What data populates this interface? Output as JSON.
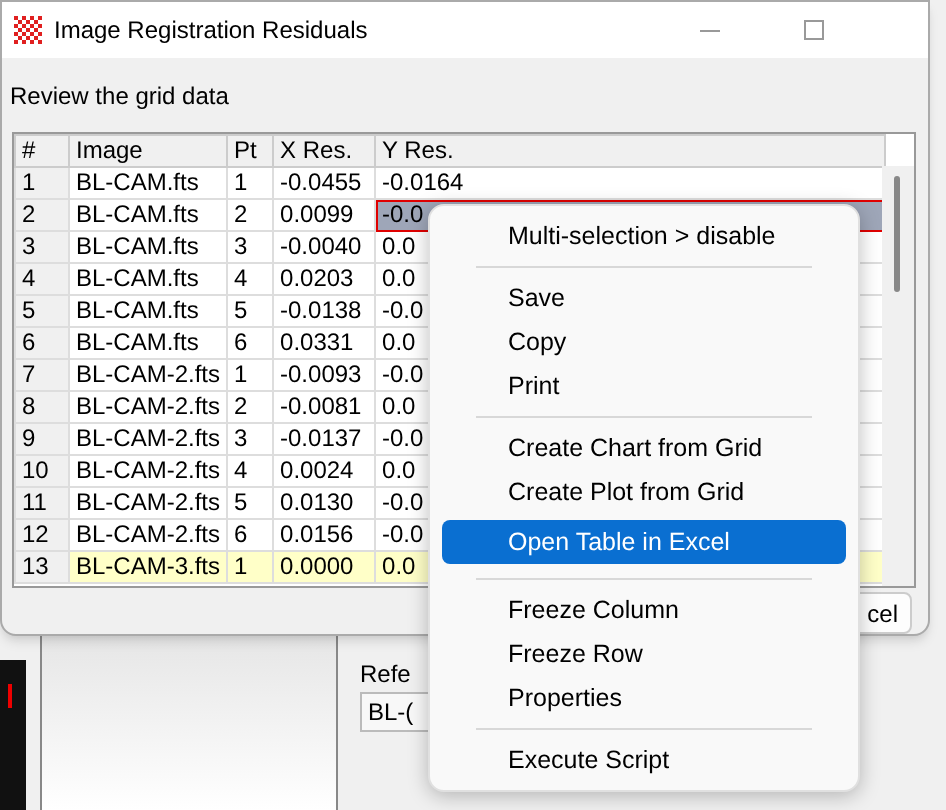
{
  "window": {
    "title": "Image Registration Residuals"
  },
  "prompt": "Review the grid data",
  "table": {
    "columns": [
      "#",
      "Image",
      "Pt",
      "X Res.",
      "Y Res."
    ],
    "rows": [
      {
        "cells": [
          "1",
          "BL-CAM.fts",
          "1",
          "-0.0455",
          "-0.0164"
        ],
        "selected": false,
        "cell_selected": false
      },
      {
        "cells": [
          "2",
          "BL-CAM.fts",
          "2",
          "0.0099",
          "-0.0"
        ],
        "selected": false,
        "cell_selected": true
      },
      {
        "cells": [
          "3",
          "BL-CAM.fts",
          "3",
          "-0.0040",
          "0.0"
        ],
        "selected": false,
        "cell_selected": false
      },
      {
        "cells": [
          "4",
          "BL-CAM.fts",
          "4",
          "0.0203",
          "0.0"
        ],
        "selected": false,
        "cell_selected": false
      },
      {
        "cells": [
          "5",
          "BL-CAM.fts",
          "5",
          "-0.0138",
          "-0.0"
        ],
        "selected": false,
        "cell_selected": false
      },
      {
        "cells": [
          "6",
          "BL-CAM.fts",
          "6",
          "0.0331",
          "0.0"
        ],
        "selected": false,
        "cell_selected": false
      },
      {
        "cells": [
          "7",
          "BL-CAM-2.fts",
          "1",
          "-0.0093",
          "-0.0"
        ],
        "selected": false,
        "cell_selected": false
      },
      {
        "cells": [
          "8",
          "BL-CAM-2.fts",
          "2",
          "-0.0081",
          "0.0"
        ],
        "selected": false,
        "cell_selected": false
      },
      {
        "cells": [
          "9",
          "BL-CAM-2.fts",
          "3",
          "-0.0137",
          "-0.0"
        ],
        "selected": false,
        "cell_selected": false
      },
      {
        "cells": [
          "10",
          "BL-CAM-2.fts",
          "4",
          "0.0024",
          "0.0"
        ],
        "selected": false,
        "cell_selected": false
      },
      {
        "cells": [
          "11",
          "BL-CAM-2.fts",
          "5",
          "0.0130",
          "-0.0"
        ],
        "selected": false,
        "cell_selected": false
      },
      {
        "cells": [
          "12",
          "BL-CAM-2.fts",
          "6",
          "0.0156",
          "-0.0"
        ],
        "selected": false,
        "cell_selected": false
      },
      {
        "cells": [
          "13",
          "BL-CAM-3.fts",
          "1",
          "0.0000",
          "0.0"
        ],
        "selected": true,
        "cell_selected": false
      }
    ]
  },
  "cancel_button": "cel",
  "context_menu": [
    {
      "kind": "item",
      "label": "Multi-selection > disable",
      "selected": false
    },
    {
      "kind": "separator"
    },
    {
      "kind": "item",
      "label": "Save",
      "selected": false
    },
    {
      "kind": "item",
      "label": "Copy",
      "selected": false
    },
    {
      "kind": "item",
      "label": "Print",
      "selected": false
    },
    {
      "kind": "separator"
    },
    {
      "kind": "item",
      "label": "Create Chart from Grid",
      "selected": false
    },
    {
      "kind": "item",
      "label": "Create Plot from Grid",
      "selected": false
    },
    {
      "kind": "item",
      "label": "Open Table in Excel",
      "selected": true
    },
    {
      "kind": "separator"
    },
    {
      "kind": "item",
      "label": "Freeze Column",
      "selected": false
    },
    {
      "kind": "item",
      "label": "Freeze Row",
      "selected": false
    },
    {
      "kind": "item",
      "label": "Properties",
      "selected": false
    },
    {
      "kind": "separator"
    },
    {
      "kind": "item",
      "label": "Execute Script",
      "selected": false
    }
  ],
  "background": {
    "label": "Refe",
    "field_value": "BL-("
  }
}
